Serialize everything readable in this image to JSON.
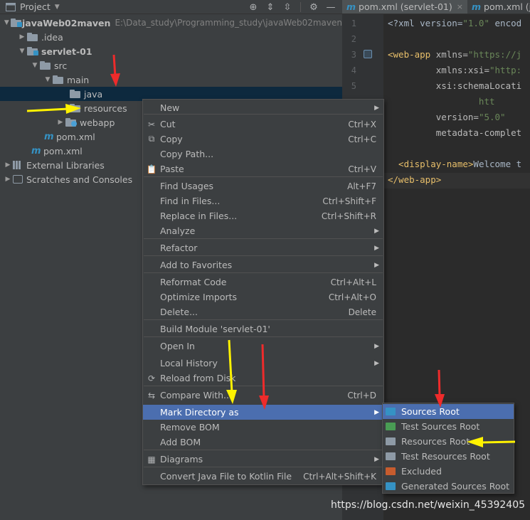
{
  "project_panel": {
    "title": "Project",
    "header_icons": [
      "crosshair-icon",
      "expand-all-icon",
      "collapse-all-icon",
      "gear-icon"
    ]
  },
  "tree": {
    "root_name": "javaWeb02maven",
    "root_path": "E:\\Data_study\\Programming_study\\javaWeb02maven",
    "idea": ".idea",
    "module": "servlet-01",
    "src": "src",
    "main": "main",
    "java": "java",
    "resources": "resources",
    "webapp": "webapp",
    "pom_module": "pom.xml",
    "pom_root": "pom.xml",
    "external_libraries": "External Libraries",
    "scratches": "Scratches and Consoles"
  },
  "editor": {
    "tabs": [
      {
        "label": "pom.xml (servlet-01)",
        "close": "×"
      },
      {
        "label": "pom.xml (ja"
      }
    ],
    "line_numbers": [
      "1",
      "2",
      "3",
      "4",
      "5"
    ],
    "code": {
      "l1_a": "<?xml version=",
      "l1_b": "\"1.0\"",
      "l1_c": " encod",
      "l3_a": "<web-app",
      "l3_b": " xmlns=",
      "l3_c": "\"https://j",
      "l4_a": "         xmlns:xsi=",
      "l4_b": "\"http:",
      "l5_a": "         xsi:schemaLocati",
      "l6_a": "                 htt",
      "l7_a": "         version=",
      "l7_b": "\"5.0\"",
      "l8_a": "         metadata-complet",
      "l10_a": "  <display-name>",
      "l10_b": "Welcome t",
      "l11_a": "</web-app>"
    }
  },
  "context_menu": {
    "items": [
      {
        "label": "New",
        "shortcut": "",
        "submenu": true,
        "icon": ""
      },
      {
        "label": "Cut",
        "shortcut": "Ctrl+X",
        "icon": "✂"
      },
      {
        "label": "Copy",
        "shortcut": "Ctrl+C",
        "icon": "⧉"
      },
      {
        "label": "Copy Path...",
        "shortcut": "",
        "icon": ""
      },
      {
        "label": "Paste",
        "shortcut": "Ctrl+V",
        "icon": "📋"
      },
      {
        "label": "Find Usages",
        "shortcut": "Alt+F7",
        "icon": ""
      },
      {
        "label": "Find in Files...",
        "shortcut": "Ctrl+Shift+F",
        "icon": ""
      },
      {
        "label": "Replace in Files...",
        "shortcut": "Ctrl+Shift+R",
        "icon": ""
      },
      {
        "label": "Analyze",
        "shortcut": "",
        "submenu": true,
        "icon": ""
      },
      {
        "label": "Refactor",
        "shortcut": "",
        "submenu": true,
        "icon": ""
      },
      {
        "label": "Add to Favorites",
        "shortcut": "",
        "submenu": true,
        "icon": ""
      },
      {
        "label": "Reformat Code",
        "shortcut": "Ctrl+Alt+L",
        "icon": ""
      },
      {
        "label": "Optimize Imports",
        "shortcut": "Ctrl+Alt+O",
        "icon": ""
      },
      {
        "label": "Delete...",
        "shortcut": "Delete",
        "icon": ""
      },
      {
        "label": "Build Module 'servlet-01'",
        "shortcut": "",
        "icon": ""
      },
      {
        "label": "Open In",
        "shortcut": "",
        "submenu": true,
        "icon": ""
      },
      {
        "label": "Local History",
        "shortcut": "",
        "submenu": true,
        "icon": ""
      },
      {
        "label": "Reload from Disk",
        "shortcut": "",
        "icon": "⟳"
      },
      {
        "label": "Compare With...",
        "shortcut": "Ctrl+D",
        "icon": "⇆"
      },
      {
        "label": "Mark Directory as",
        "shortcut": "",
        "submenu": true,
        "icon": ""
      },
      {
        "label": "Remove BOM",
        "shortcut": "",
        "icon": ""
      },
      {
        "label": "Add BOM",
        "shortcut": "",
        "icon": ""
      },
      {
        "label": "Diagrams",
        "shortcut": "",
        "submenu": true,
        "icon": "▦"
      },
      {
        "label": "Convert Java File to Kotlin File",
        "shortcut": "Ctrl+Alt+Shift+K",
        "icon": ""
      }
    ],
    "submenu_arrow": "▶"
  },
  "mark_submenu": {
    "items": [
      {
        "label": "Sources Root",
        "color": "#3592c4"
      },
      {
        "label": "Test Sources Root",
        "color": "#499c54"
      },
      {
        "label": "Resources Root",
        "color": "#8e9aa6"
      },
      {
        "label": "Test Resources Root",
        "color": "#8e9aa6"
      },
      {
        "label": "Excluded",
        "color": "#c75c2e"
      },
      {
        "label": "Generated Sources Root",
        "color": "#3592c4"
      }
    ]
  },
  "watermark": "https://blog.csdn.net/weixin_45392405",
  "colors": {
    "highlight": "#4b6eaf",
    "annotation_red": "#ee2b2b",
    "annotation_yellow": "#fff200"
  }
}
